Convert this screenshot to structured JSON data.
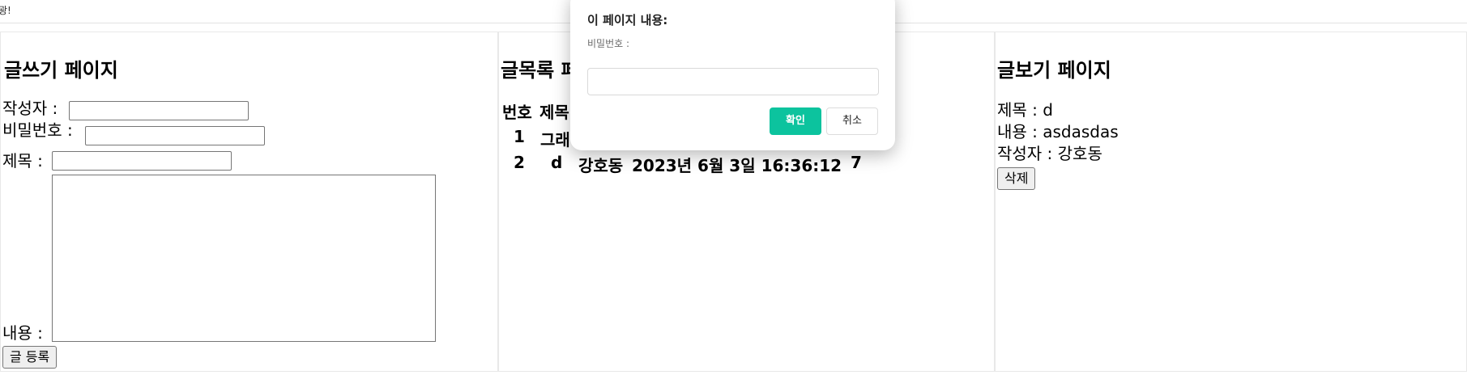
{
  "topbar": {
    "fragment": "광!"
  },
  "write_panel": {
    "title": "글쓰기 페이지",
    "author_label": "작성자 :",
    "password_label": "비밀번호 :",
    "subject_label": "제목 :",
    "content_label": "내용 :",
    "submit_label": "글 등록"
  },
  "list_panel": {
    "title": "글목록 페이지",
    "headers": [
      "번호",
      "제목"
    ],
    "rows": [
      {
        "no": "1",
        "title": "그래",
        "author": "",
        "date": "",
        "views": ""
      },
      {
        "no": "2",
        "title": "d",
        "author": "강호동",
        "date": "2023년 6월 3일 16:36:12",
        "views": "7"
      }
    ]
  },
  "view_panel": {
    "title": "글보기 페이지",
    "subject_line": "제목 : d",
    "content_line": "내용 : asdasdas",
    "author_line": "작성자 : 강호동",
    "delete_label": "삭제"
  },
  "dialog": {
    "title": "이 페이지 내용:",
    "message": "비밀번호 :",
    "ok_label": "확인",
    "cancel_label": "취소",
    "ok_color": "#0cc39e"
  }
}
